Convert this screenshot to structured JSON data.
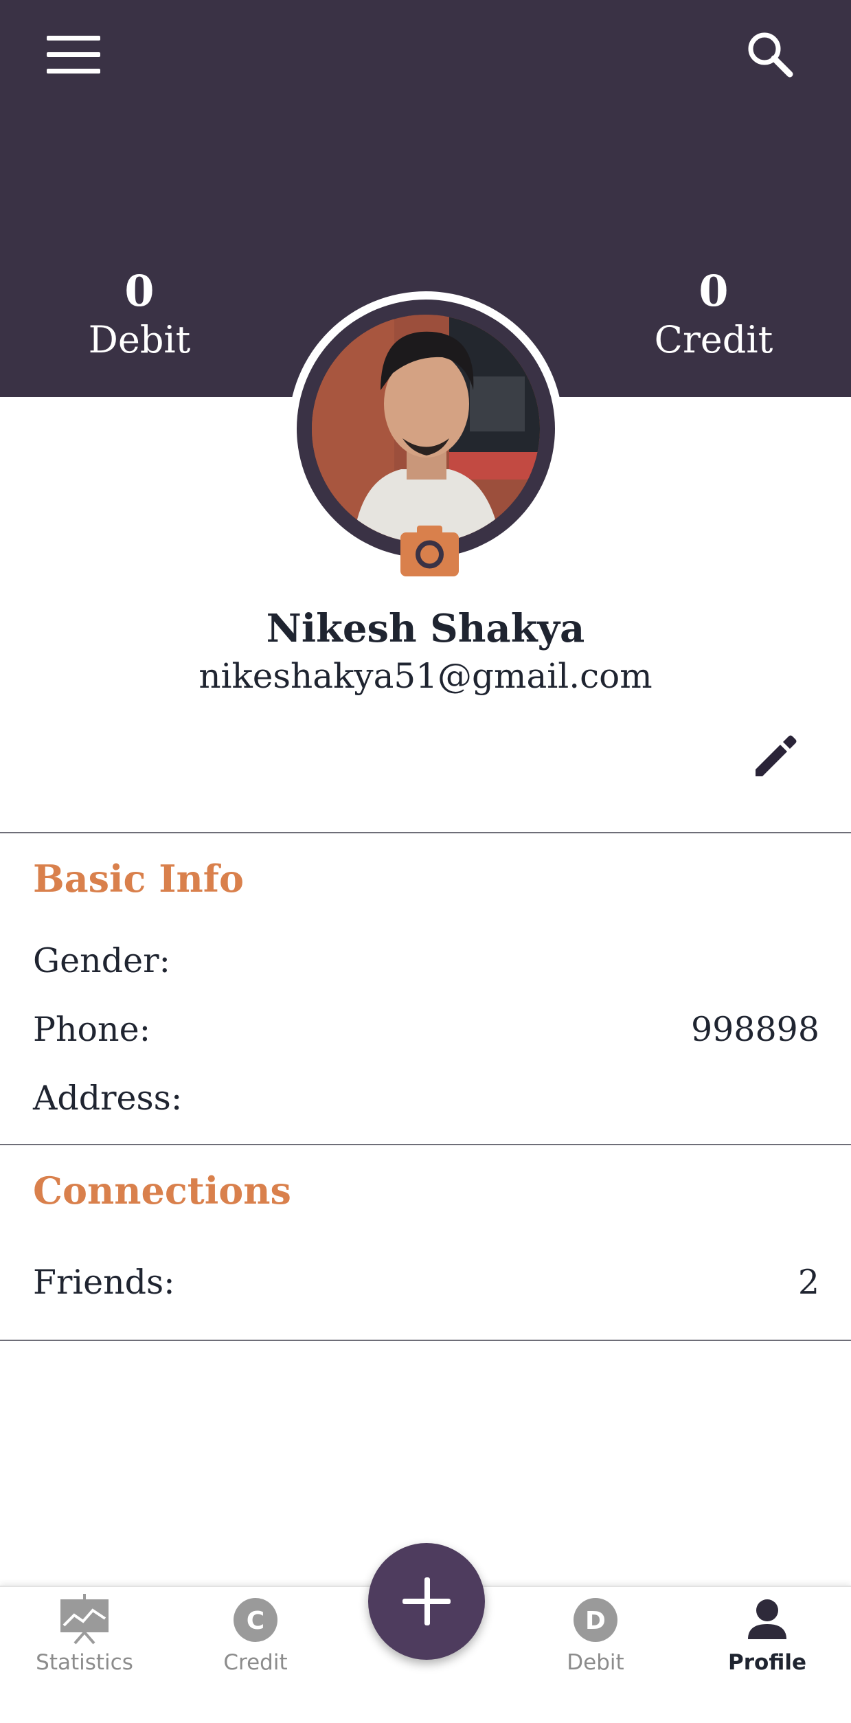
{
  "header": {
    "menu_icon": "hamburger-menu-icon",
    "search_icon": "search-icon",
    "debit": {
      "value": "0",
      "label": "Debit"
    },
    "credit": {
      "value": "0",
      "label": "Credit"
    }
  },
  "profile": {
    "name": "Nikesh Shakya",
    "email": "nikeshakya51@gmail.com",
    "camera_icon": "camera-icon",
    "edit_icon": "pencil-edit-icon"
  },
  "basic_info": {
    "title": "Basic Info",
    "rows": [
      {
        "label": "Gender:",
        "value": ""
      },
      {
        "label": "Phone:",
        "value": "998898"
      },
      {
        "label": "Address:",
        "value": ""
      }
    ]
  },
  "connections": {
    "title": "Connections",
    "rows": [
      {
        "label": "Friends:",
        "value": "2"
      }
    ]
  },
  "bottom_nav": {
    "fab_icon": "plus-icon",
    "items": [
      {
        "label": "Statistics",
        "icon": "statistics-icon",
        "active": false
      },
      {
        "label": "Credit",
        "icon": "credit-c-icon",
        "active": false
      },
      {
        "label": "Debit",
        "icon": "debit-d-icon",
        "active": false
      },
      {
        "label": "Profile",
        "icon": "person-icon",
        "active": true
      }
    ]
  },
  "colors": {
    "header_bg": "#3a3245",
    "accent": "#d9804c",
    "fab": "#4e3c5e",
    "text": "#1f2430"
  }
}
